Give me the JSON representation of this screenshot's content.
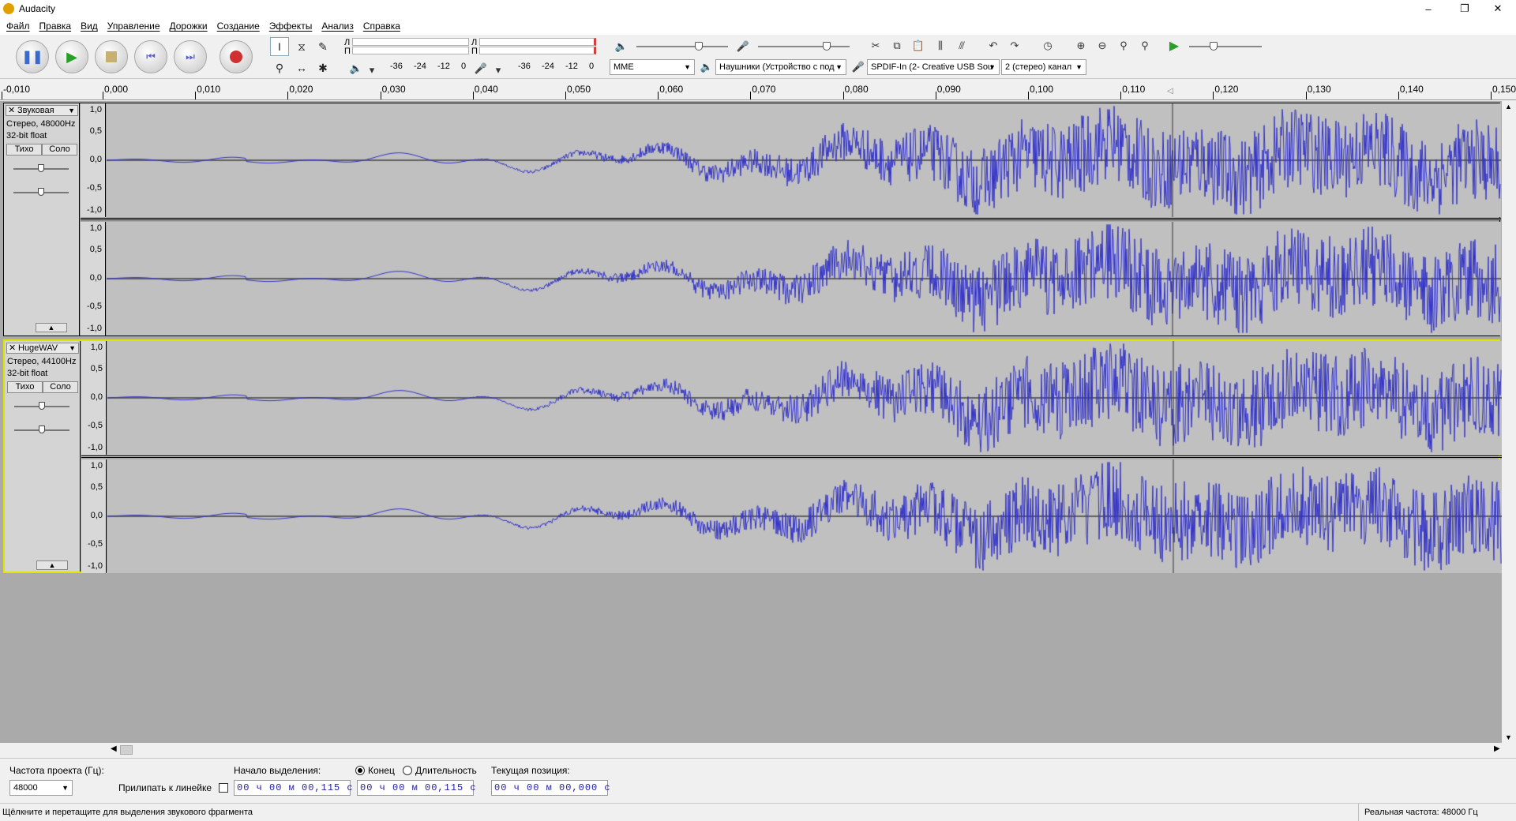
{
  "window": {
    "title": "Audacity",
    "minimize": "–",
    "maximize": "❐",
    "close": "✕"
  },
  "menu": [
    "Файл",
    "Правка",
    "Вид",
    "Управление",
    "Дорожки",
    "Создание",
    "Эффекты",
    "Анализ",
    "Справка"
  ],
  "meters": {
    "play_ticks": [
      "-36",
      "-24",
      "-12",
      "0"
    ],
    "rec_ticks": [
      "-36",
      "-24",
      "-12",
      "0"
    ],
    "lr_left": "Л",
    "lr_right": "П"
  },
  "devices": {
    "host": "MME",
    "output": "Наушники (Устройство с под",
    "input": "SPDIF-In (2- Creative USB Sou",
    "channels": "2 (стерео) канал"
  },
  "ruler": {
    "labels": [
      "-0,010",
      "0,000",
      "0,010",
      "0,020",
      "0,030",
      "0,040",
      "0,050",
      "0,060",
      "0,070",
      "0,080",
      "0,090",
      "0,100",
      "0,110",
      "0,120",
      "0,130",
      "0,140",
      "0,150"
    ]
  },
  "tracks": [
    {
      "name": "Звуковая",
      "info1": "Стерео, 48000Hz",
      "info2": "32-bit float",
      "mute": "Тихо",
      "solo": "Соло",
      "scale": [
        "1,0",
        "0,5",
        "0,0",
        "-0,5",
        "-1,0"
      ],
      "selected": false
    },
    {
      "name": "HugeWAV",
      "info1": "Стерео, 44100Hz",
      "info2": "32-bit float",
      "mute": "Тихо",
      "solo": "Соло",
      "scale": [
        "1,0",
        "0,5",
        "0,0",
        "-0,5",
        "-1,0"
      ],
      "selected": true
    }
  ],
  "selection": {
    "rate_label": "Частота проекта (Гц):",
    "rate_value": "48000",
    "snap_label": "Прилипать к линейке",
    "start_label": "Начало выделения:",
    "start_value": "00 ч 00 м 00,115 с",
    "end_label": "Конец",
    "length_label": "Длительность",
    "end_value": "00 ч 00 м 00,115 с",
    "pos_label": "Текущая позиция:",
    "pos_value": "00 ч 00 м 00,000 с"
  },
  "status": {
    "hint": "Щёлкните и перетащите для выделения звукового фрагмента",
    "rate": "Реальная частота: 48000 Гц"
  },
  "colors": {
    "waveform": "#3232c8",
    "wave_bg": "#c0c0c0",
    "selected_border": "#e4e400"
  }
}
